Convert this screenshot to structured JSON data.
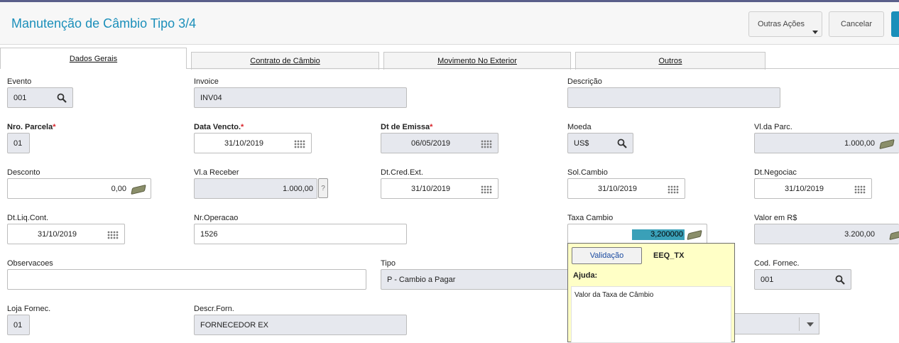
{
  "header": {
    "title": "Manutenção de Câmbio Tipo 3/4",
    "outras_acoes": "Outras Ações",
    "cancelar": "Cancelar"
  },
  "tabs": [
    "Dados Gerais",
    "Contrato de Câmbio",
    "Movimento No Exterior",
    "Outros"
  ],
  "fields": {
    "evento": {
      "label": "Evento",
      "value": "001"
    },
    "invoice": {
      "label": "Invoice",
      "value": "INV04"
    },
    "descricao": {
      "label": "Descrição",
      "value": ""
    },
    "nro_parcela": {
      "label": "Nro. Parcela",
      "value": "01"
    },
    "data_vencto": {
      "label": "Data Vencto.",
      "value": "31/10/2019"
    },
    "dt_emissa": {
      "label": "Dt de Emissa",
      "value": "06/05/2019"
    },
    "moeda": {
      "label": "Moeda",
      "value": "US$"
    },
    "vl_parc": {
      "label": "Vl.da Parc.",
      "value": "1.000,00"
    },
    "desconto": {
      "label": "Desconto",
      "value": "0,00"
    },
    "vl_receber": {
      "label": "Vl.a Receber",
      "value": "1.000,00",
      "help": "?"
    },
    "dt_cred_ext": {
      "label": "Dt.Cred.Ext.",
      "value": "31/10/2019"
    },
    "sol_cambio": {
      "label": "Sol.Cambio",
      "value": "31/10/2019"
    },
    "dt_negociac": {
      "label": "Dt.Negociac",
      "value": "31/10/2019"
    },
    "dt_liq_cont": {
      "label": "Dt.Liq.Cont.",
      "value": "31/10/2019"
    },
    "nr_operacao": {
      "label": "Nr.Operacao",
      "value": "1526"
    },
    "taxa_cambio": {
      "label": "Taxa Cambio",
      "value": "3,200000"
    },
    "valor_rs": {
      "label": "Valor em R$",
      "value": "3.200,00"
    },
    "observacoes": {
      "label": "Observacoes",
      "value": ""
    },
    "tipo": {
      "label": "Tipo",
      "value": "P - Cambio a Pagar"
    },
    "cod_fornec": {
      "label": "Cod. Fornec.",
      "value": "001"
    },
    "loja_fornec": {
      "label": "Loja Fornec.",
      "value": "01"
    },
    "descr_forn": {
      "label": "Descr.Forn.",
      "value": "FORNECEDOR EX"
    }
  },
  "help_popup": {
    "button": "Validação",
    "code": "EEQ_TX",
    "ajuda_label": "Ajuda:",
    "text": "Valor da Taxa de Câmbio"
  },
  "colors": {
    "accent": "#1b8fba",
    "readonly": "#e6e8ee",
    "help_bg": "#ffffc6",
    "required": "#d8232a"
  }
}
